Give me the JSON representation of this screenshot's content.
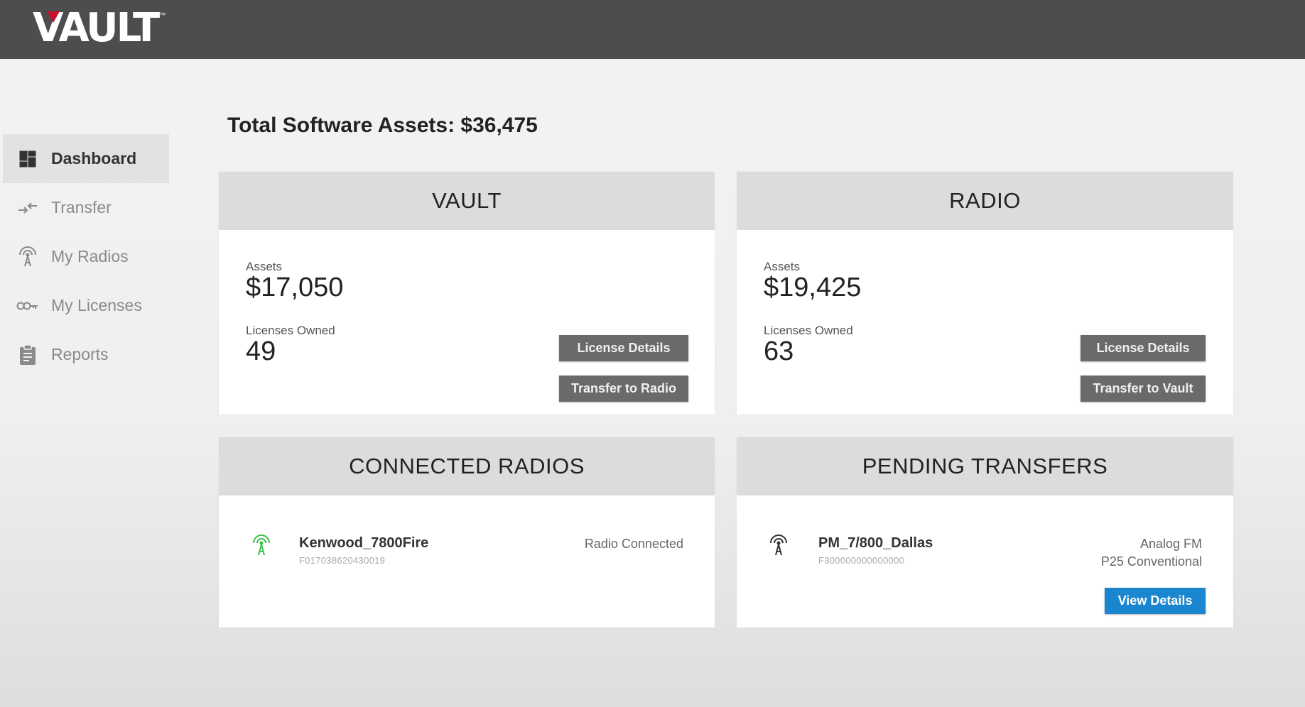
{
  "app": {
    "logo_text": "VAULT",
    "logo_tm": "™"
  },
  "sidebar": {
    "items": [
      {
        "label": "Dashboard",
        "icon": "dashboard-icon"
      },
      {
        "label": "Transfer",
        "icon": "transfer-icon"
      },
      {
        "label": "My Radios",
        "icon": "radio-icon"
      },
      {
        "label": "My Licenses",
        "icon": "key-icon"
      },
      {
        "label": "Reports",
        "icon": "clipboard-icon"
      }
    ]
  },
  "header": {
    "total": "Total Software Assets: $36,475"
  },
  "vault": {
    "title": "VAULT",
    "assets_label": "Assets",
    "assets_value": "$17,050",
    "licenses_label": "Licenses Owned",
    "licenses_value": "49",
    "btn_details": "License Details",
    "btn_transfer": "Transfer to Radio"
  },
  "radio": {
    "title": "RADIO",
    "assets_label": "Assets",
    "assets_value": "$19,425",
    "licenses_label": "Licenses Owned",
    "licenses_value": "63",
    "btn_details": "License Details",
    "btn_transfer": "Transfer to Vault"
  },
  "connected": {
    "title": "CONNECTED RADIOS",
    "name": "Kenwood_7800Fire",
    "serial": "F017038620430019",
    "status": "Radio Connected",
    "icon_color": "#3cc24a"
  },
  "pending": {
    "title": "PENDING TRANSFERS",
    "name": "PM_7/800_Dallas",
    "serial": "F300000000000000",
    "status_line1": "Analog FM",
    "status_line2": "P25 Conventional",
    "btn_view": "View Details"
  },
  "colors": {
    "accent_blue": "#1a86cf",
    "logo_red": "#c8102e",
    "topbar": "#4d4d4d"
  }
}
